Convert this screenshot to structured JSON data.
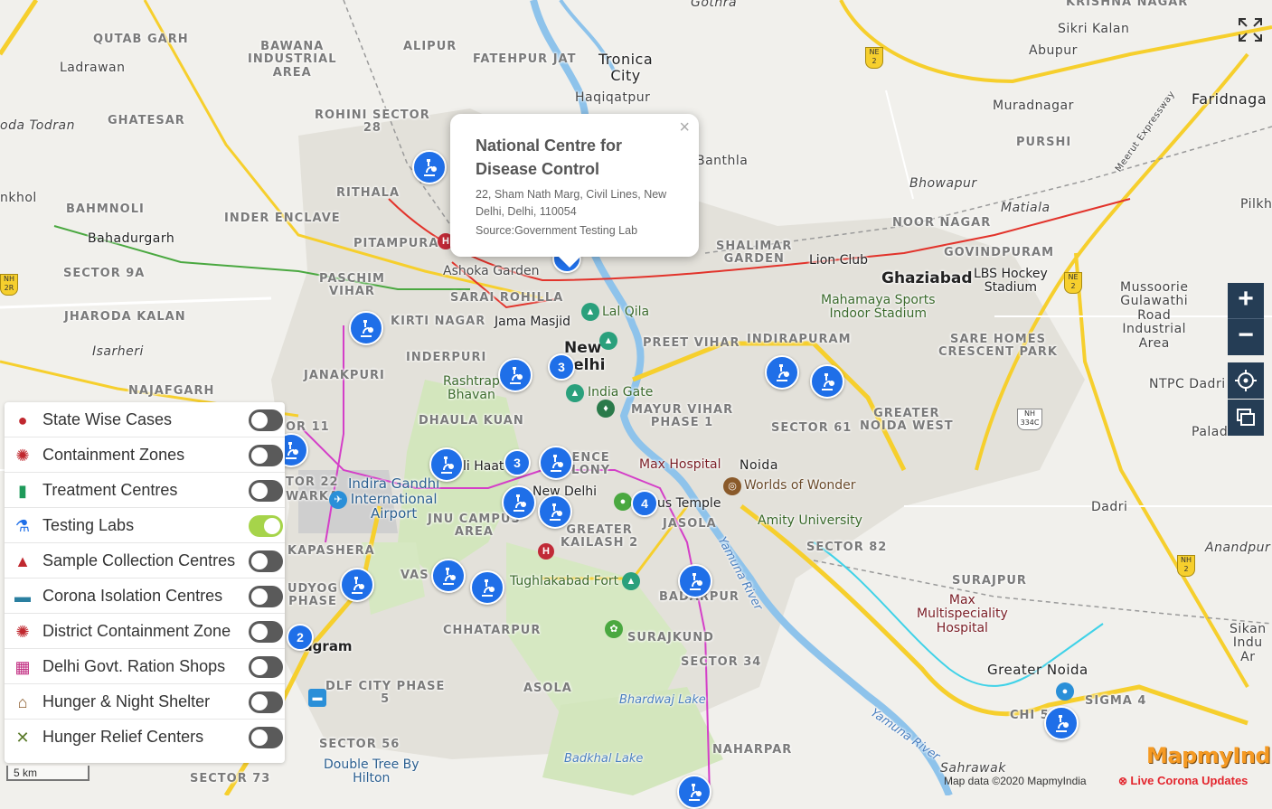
{
  "map": {
    "colors": {
      "background": "#f1f0ec",
      "green": "#cfe3b7",
      "water": "#8ec3eb",
      "yellow_road": "#f6cf2d",
      "urban": "#dedcd5"
    },
    "labels": {
      "qutab_garh": "QUTAB GARH",
      "bawana": "BAWANA\nINDUSTRIAL\nAREA",
      "alipur": "ALIPUR",
      "fatehpur_jat": "FATEHPUR JAT",
      "tronica_city": "Tronica\nCity",
      "gothra": "Gothra",
      "krishna_nagar": "KRISHNA NAGAR",
      "sikri_kalan": "Sikri Kalan",
      "abupur": "Abupur",
      "faridnagar": "Faridnaga",
      "ladrawan": "Ladrawan",
      "ghatesar": "GHATESAR",
      "oda_todran": "oda Todran",
      "haqiqatpur": "Haqiqatpur",
      "rohini_sector_28": "ROHINI SECTOR\n28",
      "muradnagar": "Muradnagar",
      "purshi": "PURSHI",
      "bhowapur": "Bhowapur",
      "matiala": "Matiala",
      "pilkh": "Pilkh",
      "nkhol": "nkhol",
      "rithala": "RITHALA",
      "banthla": "Banthla",
      "bahmnoli": "BAHMNOLI",
      "inder_enclave": "INDER ENCLAVE",
      "noor_nagar": "NOOR NAGAR",
      "bahadurgarh": "Bahadurgarh",
      "pitampura": "PITAMPURA",
      "shalimar_garden": "SHALIMAR\nGARDEN",
      "govindpuram": "GOVINDPURAM",
      "sector_9a": "SECTOR 9A",
      "ashoka_garden": "Ashoka Garden",
      "lion_club": "Lion Club",
      "ghaziabad": "Ghaziabad",
      "lbs_stadium": "LBS Hockey\nStadium",
      "paschim_vihar": "PASCHIM\nVIHAR",
      "sarai_rohilla": "SARAI ROHILLA",
      "mahamaya": "Mahamaya Sports\nIndoor Stadium",
      "mussoorie": "Mussoorie\nGulawathi\nRoad\nIndustrial\nArea",
      "jharoda_kalan": "JHARODA KALAN",
      "kirti_nagar": "KIRTI NAGAR",
      "jama_masjid": "Jama Masjid",
      "lal_qila": "Lal Qila",
      "new_delhi": "New\nDelhi",
      "preet_vihar": "PREET VIHAR",
      "indirapuram": "INDIRAPURAM",
      "sare_homes": "SARE HOMES\nCRESCENT PARK",
      "isarheri": "Isarheri",
      "inderpuri": "INDERPURI",
      "janakpuri": "JANAKPURI",
      "najafgarh": "NAJAFGARH",
      "rashtrapati": "Rashtrap\nBhavan",
      "india_gate": "India Gate",
      "ntpc_dadri": "NTPC Dadri",
      "mayur_vihar": "MAYUR VIHAR\nPHASE 1",
      "sector_61": "SECTOR 61",
      "greater_noida_west": "GREATER\nNOIDA WEST",
      "sector_11": "OR 11",
      "dhaula_kuan": "DHAULA KUAN",
      "paladi": "Paladi",
      "dilli_haat": "li Haat",
      "defence_colony": "ENCE\nLONY",
      "max_hospital": "Max Hospital",
      "noida": "Noida",
      "worlds_of_wonder": "Worlds of Wonder",
      "sector_22": "TOR 22",
      "dwarka": "WARKA",
      "igi_airport": "Indira Gandhi\nInternational\nAirport",
      "new_delhi_2": "New Delhi",
      "lotus_temple": "us Temple",
      "amity": "Amity University",
      "dadri": "Dadri",
      "jnu_campus": "JNU CAMPUS\nAREA",
      "greater_kailash": "GREATER\nKAILASH 2",
      "jasola": "JASOLA",
      "sector_82": "SECTOR 82",
      "anandpur": "Anandpur",
      "kapashera": "KAPASHERA",
      "vasant": "VAS",
      "tughlakabad": "Tughlakabad Fort",
      "badarpur": "BADARPUR",
      "surajpur": "SURAJPUR",
      "max_multi": "Max\nMultispeciality\nHospital",
      "udyog_vihar": "UDYOG\nPHASE",
      "yamuna_river": "Yamuna River",
      "sikandrabad": "Sikan\nIndu\nAr",
      "gurugram": "ugram",
      "chhatarpur": "CHHATARPUR",
      "surajkund": "SURAJKUND",
      "sector_34": "SECTOR 34",
      "greater_noida": "Greater Noida",
      "dlf_city": "DLF CITY PHASE\n5",
      "asola": "ASOLA",
      "bhardwaj_lake": "Bhardwaj Lake",
      "sigma_4": "SIGMA 4",
      "chi_5": "CHI 5",
      "yamuna_river_2": "Yamuna River",
      "sector_56": "SECTOR 56",
      "badkhal_lake": "Badkhal Lake",
      "naharpar": "NAHARPAR",
      "double_tree": "Double Tree By\nHilton",
      "sahrawak": "Sahrawak",
      "sector_73": "SECTOR 73",
      "meerut_expressway": "Meerut Expressway",
      "nh2": "NE\n2",
      "nh2b": "NH\n2",
      "nh334c": "NH\n334C",
      "nh2c": "NE\n2",
      "nh2d": "NH\n2",
      "nh2r": "NH\n2R"
    },
    "clusters": [
      "3",
      "3",
      "4",
      "2"
    ]
  },
  "popup": {
    "title": "National Centre for Disease Control",
    "address": "22, Sham Nath Marg, Civil Lines, New Delhi, Delhi, 110054",
    "source": "Source:Government Testing Lab",
    "close": "×"
  },
  "layers": [
    {
      "label": "State Wise Cases",
      "icon": "globe-icon",
      "color": "#c0282f",
      "enabled": false
    },
    {
      "label": "Containment Zones",
      "icon": "virus-icon",
      "color": "#c0282f",
      "enabled": false
    },
    {
      "label": "Treatment Centres",
      "icon": "building-icon",
      "color": "#1e9a5a",
      "enabled": false
    },
    {
      "label": "Testing Labs",
      "icon": "microscope-icon",
      "color": "#1f6fe8",
      "enabled": true
    },
    {
      "label": "Sample Collection Centres",
      "icon": "sample-icon",
      "color": "#c0282f",
      "enabled": false
    },
    {
      "label": "Corona Isolation Centres",
      "icon": "bed-icon",
      "color": "#2a7fa0",
      "enabled": false
    },
    {
      "label": "District Containment Zone",
      "icon": "virus-icon",
      "color": "#c0282f",
      "enabled": false
    },
    {
      "label": "Delhi Govt. Ration Shops",
      "icon": "shop-icon",
      "color": "#c0287f",
      "enabled": false
    },
    {
      "label": "Hunger & Night Shelter",
      "icon": "shelter-icon",
      "color": "#8a5a2a",
      "enabled": false
    },
    {
      "label": "Hunger Relief Centers",
      "icon": "cutlery-icon",
      "color": "#5a7a2a",
      "enabled": false
    }
  ],
  "controls": {
    "zoom_in": "+",
    "zoom_out": "−"
  },
  "scale": "5 km",
  "attribution": "Map data ©2020 MapmyIndia",
  "live_link": "Live Corona Updates",
  "brand": "MapmyIndia"
}
